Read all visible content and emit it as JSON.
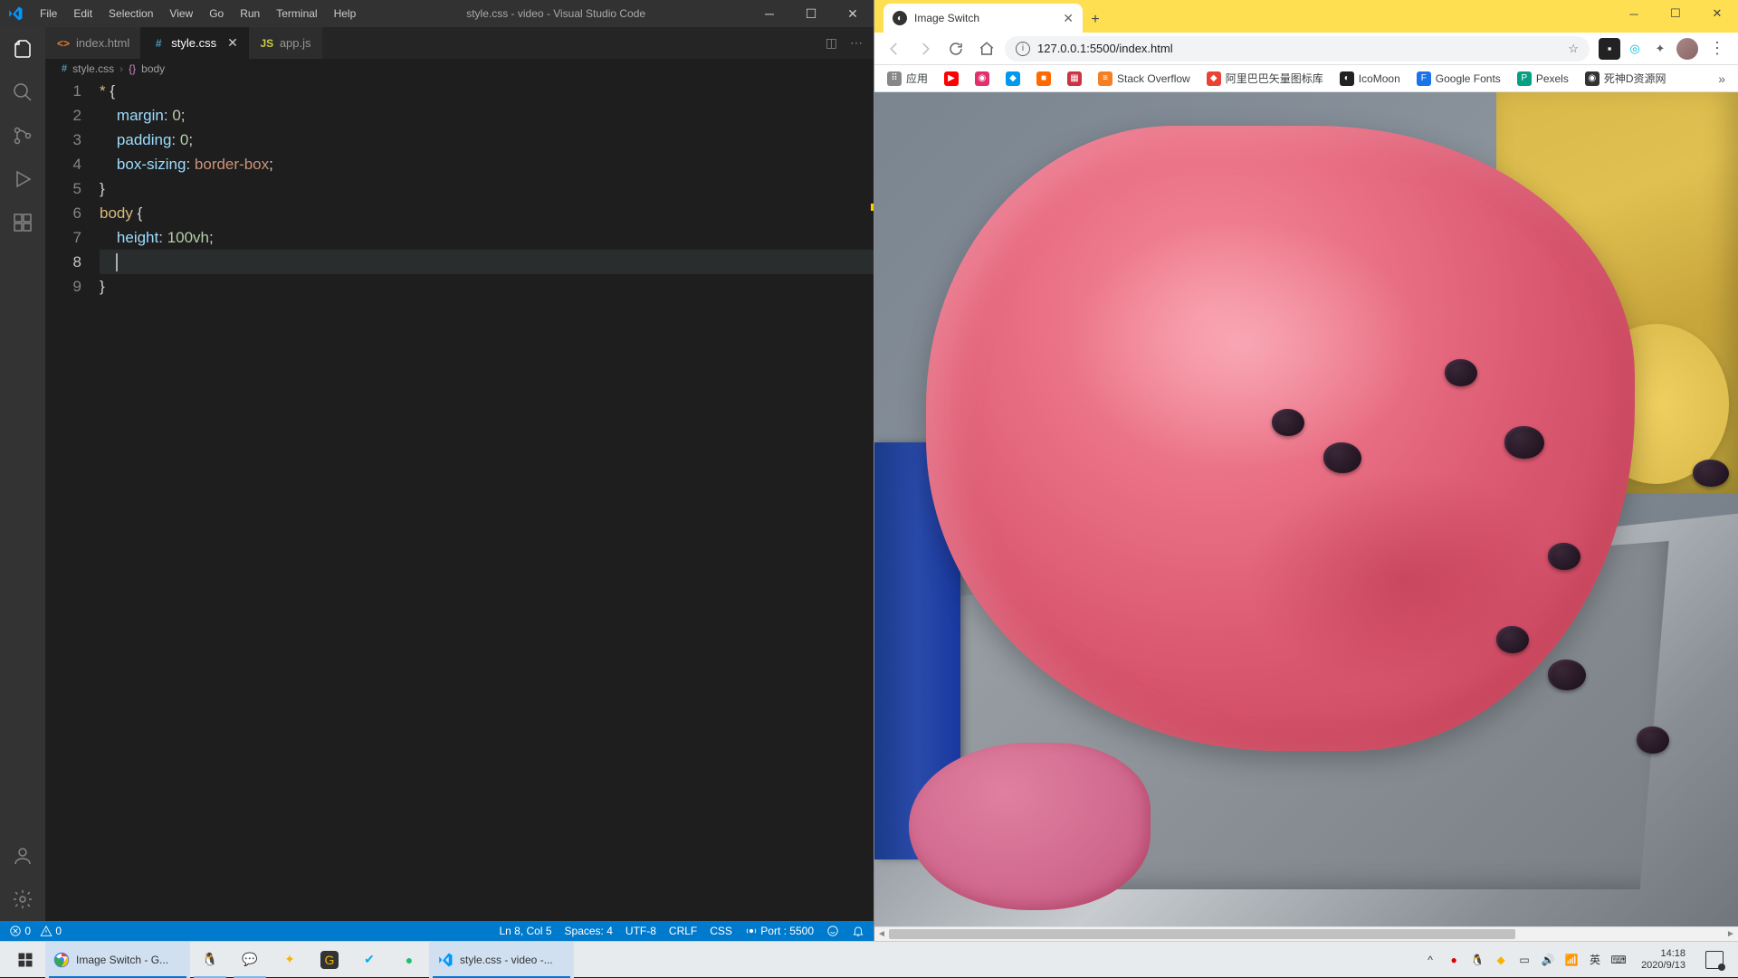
{
  "vscode": {
    "menus": [
      "File",
      "Edit",
      "Selection",
      "View",
      "Go",
      "Run",
      "Terminal",
      "Help"
    ],
    "window_title": "style.css - video - Visual Studio Code",
    "tabs": [
      {
        "name": "index.html",
        "type": "html"
      },
      {
        "name": "style.css",
        "type": "css"
      },
      {
        "name": "app.js",
        "type": "js"
      }
    ],
    "breadcrumb": {
      "file": "style.css",
      "symbol": "body"
    },
    "code_lines": [
      {
        "n": 1,
        "tokens": [
          [
            "wild",
            "*"
          ],
          [
            "punc",
            " {"
          ]
        ]
      },
      {
        "n": 2,
        "tokens": [
          [
            "punc",
            "    "
          ],
          [
            "prop",
            "margin"
          ],
          [
            "punc",
            ": "
          ],
          [
            "num",
            "0"
          ],
          [
            "punc",
            ";"
          ]
        ]
      },
      {
        "n": 3,
        "tokens": [
          [
            "punc",
            "    "
          ],
          [
            "prop",
            "padding"
          ],
          [
            "punc",
            ": "
          ],
          [
            "num",
            "0"
          ],
          [
            "punc",
            ";"
          ]
        ]
      },
      {
        "n": 4,
        "tokens": [
          [
            "punc",
            "    "
          ],
          [
            "prop",
            "box-sizing"
          ],
          [
            "punc",
            ": "
          ],
          [
            "kw",
            "border-box"
          ],
          [
            "punc",
            ";"
          ]
        ]
      },
      {
        "n": 5,
        "tokens": [
          [
            "punc",
            "}"
          ]
        ]
      },
      {
        "n": 6,
        "tokens": [
          [
            "sel",
            "body"
          ],
          [
            "punc",
            " {"
          ]
        ]
      },
      {
        "n": 7,
        "tokens": [
          [
            "punc",
            "    "
          ],
          [
            "prop",
            "height"
          ],
          [
            "punc",
            ": "
          ],
          [
            "num",
            "100vh"
          ],
          [
            "punc",
            ";"
          ]
        ]
      },
      {
        "n": 8,
        "tokens": [
          [
            "punc",
            "    "
          ]
        ],
        "current": true
      },
      {
        "n": 9,
        "tokens": [
          [
            "punc",
            "}"
          ]
        ]
      }
    ],
    "status": {
      "errors": "0",
      "warnings": "0",
      "position": "Ln 8, Col 5",
      "spaces": "Spaces: 4",
      "encoding": "UTF-8",
      "eol": "CRLF",
      "language": "CSS",
      "port": "Port : 5500"
    }
  },
  "chrome": {
    "tab_title": "Image Switch",
    "url": "127.0.0.1:5500/index.html",
    "bookmarks": [
      {
        "label": "应用",
        "color": "#888",
        "glyph": "⠿"
      },
      {
        "label": "",
        "color": "#ff0000",
        "glyph": "▶"
      },
      {
        "label": "",
        "color": "#e1306c",
        "glyph": "◉"
      },
      {
        "label": "",
        "color": "#0099ee",
        "glyph": "◆"
      },
      {
        "label": "",
        "color": "#ff6a00",
        "glyph": "■"
      },
      {
        "label": "",
        "color": "#cc3344",
        "glyph": "▦"
      },
      {
        "label": "Stack Overflow",
        "color": "#f48024",
        "glyph": "≡"
      },
      {
        "label": "阿里巴巴矢量图标库",
        "color": "#ea4335",
        "glyph": "◆"
      },
      {
        "label": "IcoMoon",
        "color": "#222",
        "glyph": "◐"
      },
      {
        "label": "Google Fonts",
        "color": "#1a73e8",
        "glyph": "F"
      },
      {
        "label": "Pexels",
        "color": "#05a081",
        "glyph": "P"
      },
      {
        "label": "死神D资源网",
        "color": "#333",
        "glyph": "◉"
      }
    ]
  },
  "taskbar": {
    "chrome_label": "Image Switch - G...",
    "vscode_label": "style.css - video -...",
    "ime": "英",
    "time": "14:18",
    "date": "2020/9/13"
  }
}
